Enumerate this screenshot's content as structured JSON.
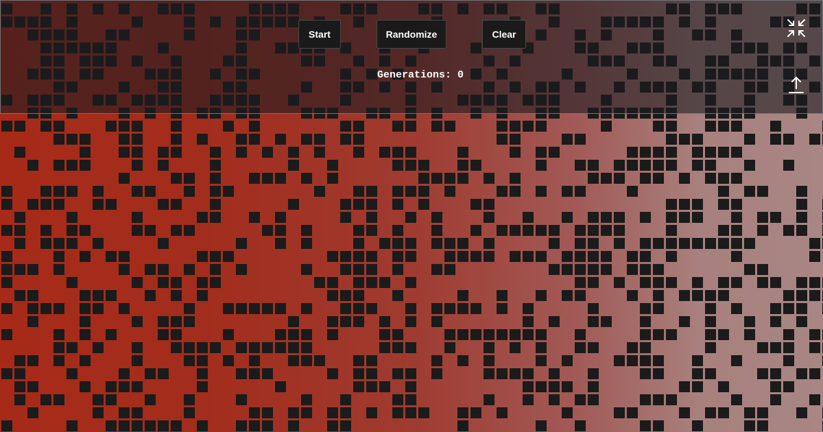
{
  "controls": {
    "start_label": "Start",
    "randomize_label": "Randomize",
    "clear_label": "Clear"
  },
  "status": {
    "generations_label": "Generations:",
    "generations_value": "0"
  },
  "icons": {
    "collapse": "collapse-arrows-icon",
    "upload": "upload-arrow-icon"
  },
  "colors": {
    "cell_alive": "#1b1b1b",
    "toolbar_text": "#ffffff",
    "button_bg": "#1a1a1a"
  },
  "grid": {
    "columns": 64,
    "rows": 34,
    "density": 0.42
  }
}
